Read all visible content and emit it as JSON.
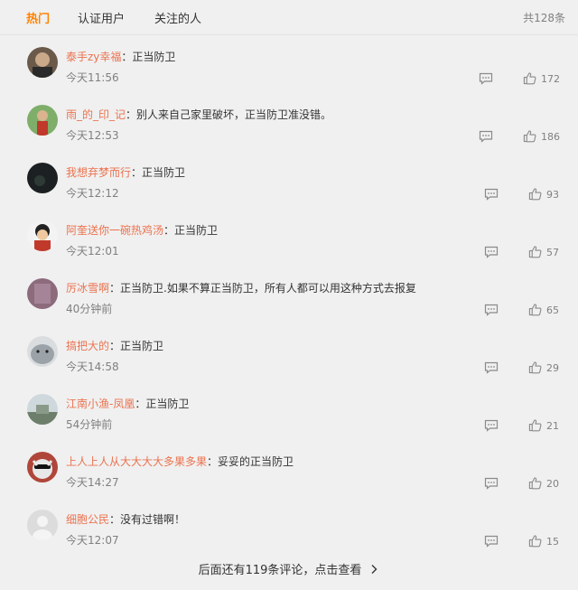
{
  "tabs": [
    "热门",
    "认证用户",
    "关注的人"
  ],
  "total": "共128条",
  "separator": "：",
  "comments": [
    {
      "user": "泰手zy幸福",
      "text": "正当防卫",
      "time": "今天11:56",
      "likes": "172"
    },
    {
      "user": "雨_的_印_记",
      "text": "别人来自己家里破坏，正当防卫准没错。",
      "time": "今天12:53",
      "likes": "186"
    },
    {
      "user": "我想弃梦而行",
      "text": "正当防卫",
      "time": "今天12:12",
      "likes": "93"
    },
    {
      "user": "阿奎送你一碗热鸡汤",
      "text": "正当防卫",
      "time": "今天12:01",
      "likes": "57"
    },
    {
      "user": "厉冰雪啊",
      "text": "正当防卫.如果不算正当防卫，所有人都可以用这种方式去报复",
      "time": "40分钟前",
      "likes": "65"
    },
    {
      "user": "搞把大的",
      "text": "正当防卫",
      "time": "今天14:58",
      "likes": "29"
    },
    {
      "user": "江南小渔-凤凰",
      "text": "正当防卫",
      "time": "54分钟前",
      "likes": "21"
    },
    {
      "user": "上人上人从大大大大多果多果",
      "text": "妥妥的正当防卫",
      "time": "今天14:27",
      "likes": "20"
    },
    {
      "user": "细胞公民",
      "text": "没有过错啊！",
      "time": "今天12:07",
      "likes": "15"
    }
  ],
  "more_link": "后面还有119条评论，点击查看",
  "colors": {
    "accent": "#ff8200",
    "username": "#eb7350",
    "muted": "#808080",
    "background": "#f0f0f0"
  }
}
